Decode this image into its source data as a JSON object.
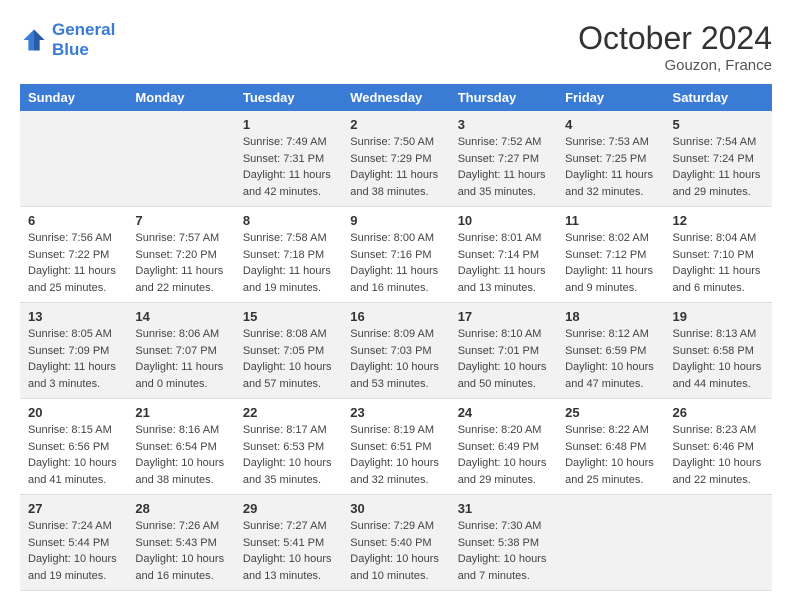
{
  "logo": {
    "line1": "General",
    "line2": "Blue"
  },
  "title": "October 2024",
  "subtitle": "Gouzon, France",
  "days_header": [
    "Sunday",
    "Monday",
    "Tuesday",
    "Wednesday",
    "Thursday",
    "Friday",
    "Saturday"
  ],
  "weeks": [
    [
      {
        "day": "",
        "sunrise": "",
        "sunset": "",
        "daylight": ""
      },
      {
        "day": "",
        "sunrise": "",
        "sunset": "",
        "daylight": ""
      },
      {
        "day": "1",
        "sunrise": "Sunrise: 7:49 AM",
        "sunset": "Sunset: 7:31 PM",
        "daylight": "Daylight: 11 hours and 42 minutes."
      },
      {
        "day": "2",
        "sunrise": "Sunrise: 7:50 AM",
        "sunset": "Sunset: 7:29 PM",
        "daylight": "Daylight: 11 hours and 38 minutes."
      },
      {
        "day": "3",
        "sunrise": "Sunrise: 7:52 AM",
        "sunset": "Sunset: 7:27 PM",
        "daylight": "Daylight: 11 hours and 35 minutes."
      },
      {
        "day": "4",
        "sunrise": "Sunrise: 7:53 AM",
        "sunset": "Sunset: 7:25 PM",
        "daylight": "Daylight: 11 hours and 32 minutes."
      },
      {
        "day": "5",
        "sunrise": "Sunrise: 7:54 AM",
        "sunset": "Sunset: 7:24 PM",
        "daylight": "Daylight: 11 hours and 29 minutes."
      }
    ],
    [
      {
        "day": "6",
        "sunrise": "Sunrise: 7:56 AM",
        "sunset": "Sunset: 7:22 PM",
        "daylight": "Daylight: 11 hours and 25 minutes."
      },
      {
        "day": "7",
        "sunrise": "Sunrise: 7:57 AM",
        "sunset": "Sunset: 7:20 PM",
        "daylight": "Daylight: 11 hours and 22 minutes."
      },
      {
        "day": "8",
        "sunrise": "Sunrise: 7:58 AM",
        "sunset": "Sunset: 7:18 PM",
        "daylight": "Daylight: 11 hours and 19 minutes."
      },
      {
        "day": "9",
        "sunrise": "Sunrise: 8:00 AM",
        "sunset": "Sunset: 7:16 PM",
        "daylight": "Daylight: 11 hours and 16 minutes."
      },
      {
        "day": "10",
        "sunrise": "Sunrise: 8:01 AM",
        "sunset": "Sunset: 7:14 PM",
        "daylight": "Daylight: 11 hours and 13 minutes."
      },
      {
        "day": "11",
        "sunrise": "Sunrise: 8:02 AM",
        "sunset": "Sunset: 7:12 PM",
        "daylight": "Daylight: 11 hours and 9 minutes."
      },
      {
        "day": "12",
        "sunrise": "Sunrise: 8:04 AM",
        "sunset": "Sunset: 7:10 PM",
        "daylight": "Daylight: 11 hours and 6 minutes."
      }
    ],
    [
      {
        "day": "13",
        "sunrise": "Sunrise: 8:05 AM",
        "sunset": "Sunset: 7:09 PM",
        "daylight": "Daylight: 11 hours and 3 minutes."
      },
      {
        "day": "14",
        "sunrise": "Sunrise: 8:06 AM",
        "sunset": "Sunset: 7:07 PM",
        "daylight": "Daylight: 11 hours and 0 minutes."
      },
      {
        "day": "15",
        "sunrise": "Sunrise: 8:08 AM",
        "sunset": "Sunset: 7:05 PM",
        "daylight": "Daylight: 10 hours and 57 minutes."
      },
      {
        "day": "16",
        "sunrise": "Sunrise: 8:09 AM",
        "sunset": "Sunset: 7:03 PM",
        "daylight": "Daylight: 10 hours and 53 minutes."
      },
      {
        "day": "17",
        "sunrise": "Sunrise: 8:10 AM",
        "sunset": "Sunset: 7:01 PM",
        "daylight": "Daylight: 10 hours and 50 minutes."
      },
      {
        "day": "18",
        "sunrise": "Sunrise: 8:12 AM",
        "sunset": "Sunset: 6:59 PM",
        "daylight": "Daylight: 10 hours and 47 minutes."
      },
      {
        "day": "19",
        "sunrise": "Sunrise: 8:13 AM",
        "sunset": "Sunset: 6:58 PM",
        "daylight": "Daylight: 10 hours and 44 minutes."
      }
    ],
    [
      {
        "day": "20",
        "sunrise": "Sunrise: 8:15 AM",
        "sunset": "Sunset: 6:56 PM",
        "daylight": "Daylight: 10 hours and 41 minutes."
      },
      {
        "day": "21",
        "sunrise": "Sunrise: 8:16 AM",
        "sunset": "Sunset: 6:54 PM",
        "daylight": "Daylight: 10 hours and 38 minutes."
      },
      {
        "day": "22",
        "sunrise": "Sunrise: 8:17 AM",
        "sunset": "Sunset: 6:53 PM",
        "daylight": "Daylight: 10 hours and 35 minutes."
      },
      {
        "day": "23",
        "sunrise": "Sunrise: 8:19 AM",
        "sunset": "Sunset: 6:51 PM",
        "daylight": "Daylight: 10 hours and 32 minutes."
      },
      {
        "day": "24",
        "sunrise": "Sunrise: 8:20 AM",
        "sunset": "Sunset: 6:49 PM",
        "daylight": "Daylight: 10 hours and 29 minutes."
      },
      {
        "day": "25",
        "sunrise": "Sunrise: 8:22 AM",
        "sunset": "Sunset: 6:48 PM",
        "daylight": "Daylight: 10 hours and 25 minutes."
      },
      {
        "day": "26",
        "sunrise": "Sunrise: 8:23 AM",
        "sunset": "Sunset: 6:46 PM",
        "daylight": "Daylight: 10 hours and 22 minutes."
      }
    ],
    [
      {
        "day": "27",
        "sunrise": "Sunrise: 7:24 AM",
        "sunset": "Sunset: 5:44 PM",
        "daylight": "Daylight: 10 hours and 19 minutes."
      },
      {
        "day": "28",
        "sunrise": "Sunrise: 7:26 AM",
        "sunset": "Sunset: 5:43 PM",
        "daylight": "Daylight: 10 hours and 16 minutes."
      },
      {
        "day": "29",
        "sunrise": "Sunrise: 7:27 AM",
        "sunset": "Sunset: 5:41 PM",
        "daylight": "Daylight: 10 hours and 13 minutes."
      },
      {
        "day": "30",
        "sunrise": "Sunrise: 7:29 AM",
        "sunset": "Sunset: 5:40 PM",
        "daylight": "Daylight: 10 hours and 10 minutes."
      },
      {
        "day": "31",
        "sunrise": "Sunrise: 7:30 AM",
        "sunset": "Sunset: 5:38 PM",
        "daylight": "Daylight: 10 hours and 7 minutes."
      },
      {
        "day": "",
        "sunrise": "",
        "sunset": "",
        "daylight": ""
      },
      {
        "day": "",
        "sunrise": "",
        "sunset": "",
        "daylight": ""
      }
    ]
  ]
}
